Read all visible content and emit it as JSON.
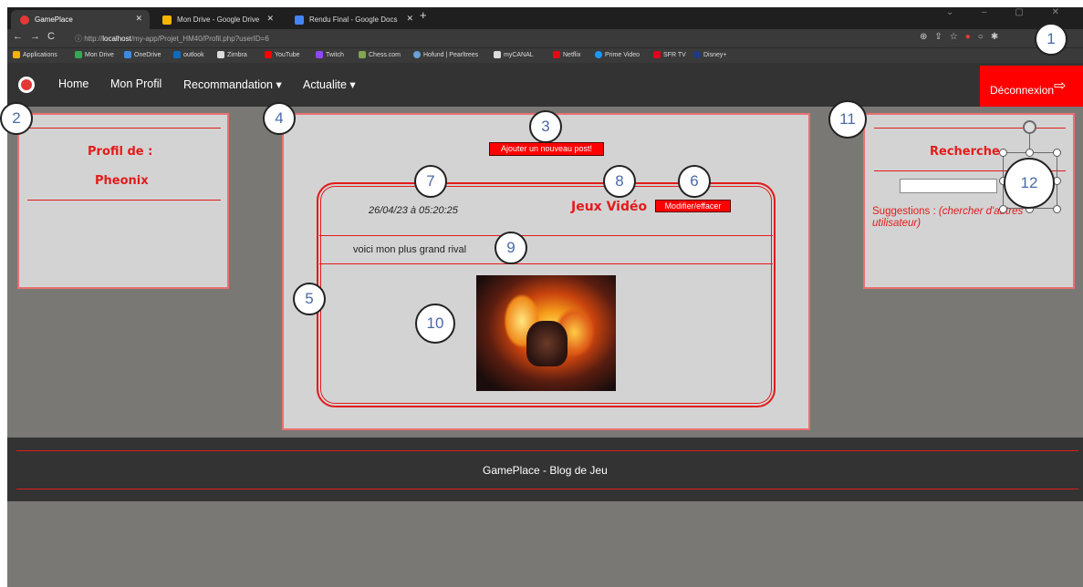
{
  "browser": {
    "tabs": [
      {
        "title": "GamePlace"
      },
      {
        "title": "Mon Drive - Google Drive"
      },
      {
        "title": "Rendu Final - Google Docs"
      }
    ],
    "new_tab": "+",
    "url_prefix": "http://",
    "url_host": "localhost",
    "url_path": "/my-app/Projet_HM40/Profil.php?userID=6",
    "bookmarks": [
      "Applications",
      "Mon Drive",
      "OneDrive",
      "outlook",
      "Zimbra",
      "YouTube",
      "Twitch",
      "Chess.com",
      "Hofund | Pearltrees",
      "myCANAL",
      "Netflix",
      "Prime Video",
      "SFR TV",
      "Disney+"
    ]
  },
  "nav": {
    "home": "Home",
    "profile": "Mon Profil",
    "recommandation": "Recommandation ▾",
    "actualite": "Actualite ▾",
    "logout": "Déconnexion"
  },
  "profile": {
    "heading": "Profil de :",
    "username": "Pheonix"
  },
  "feed": {
    "add_post": "Ajouter un nouveau post!",
    "post": {
      "date": "26/04/23 à 05:20:25",
      "category": "Jeux Vidéo",
      "edit_button": "Modifier/effacer",
      "text": "voici mon plus grand rival"
    }
  },
  "search": {
    "heading": "Recherche",
    "suggestions_label": "Suggestions : ",
    "suggestions_hint": "(chercher d'autres utilisateur)"
  },
  "footer": {
    "text": "GamePlace - Blog de Jeu"
  },
  "annotations": [
    "1",
    "2",
    "3",
    "4",
    "5",
    "6",
    "7",
    "8",
    "9",
    "10",
    "11",
    "12"
  ],
  "colors": {
    "accent_red": "#e31b1b",
    "panel": "#d3d3d3",
    "navbar": "#333333",
    "page_bg": "#7a7875"
  }
}
